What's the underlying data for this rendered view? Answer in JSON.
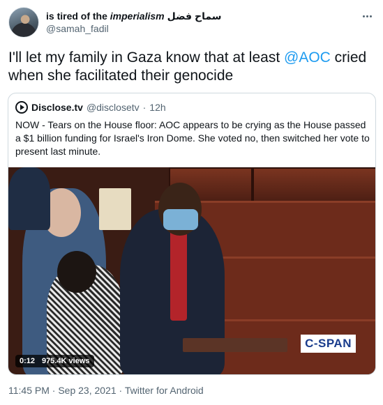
{
  "author": {
    "display_name_prefix": "is tired of the ",
    "display_name_italic": "imperialism",
    "display_name_arabic": "سماح فضل",
    "handle": "@samah_fadil"
  },
  "tweet": {
    "text_before": "I'll let my family in Gaza know that at least ",
    "mention": "@AOC",
    "text_after": " cried when she facilitated their genocide"
  },
  "quoted": {
    "name": "Disclose.tv",
    "handle": "@disclosetv",
    "separator": "·",
    "time": "12h",
    "text": "NOW - Tears on the House floor: AOC appears to be crying as the House passed a $1 billion funding for Israel's Iron Dome. She voted no, then switched her vote to present last minute.",
    "video": {
      "duration": "0:12",
      "views": "975.4K views",
      "watermark": "C-SPAN"
    }
  },
  "footer": {
    "time": "11:45 PM",
    "sep": "·",
    "date": "Sep 23, 2021",
    "source": "Twitter for Android"
  },
  "icons": {
    "more": "more-horizontal-icon",
    "quoted_avatar": "play-logo-icon"
  },
  "colors": {
    "accent": "#1d9bf0",
    "secondary_text": "#536471",
    "border": "#cfd9de"
  }
}
